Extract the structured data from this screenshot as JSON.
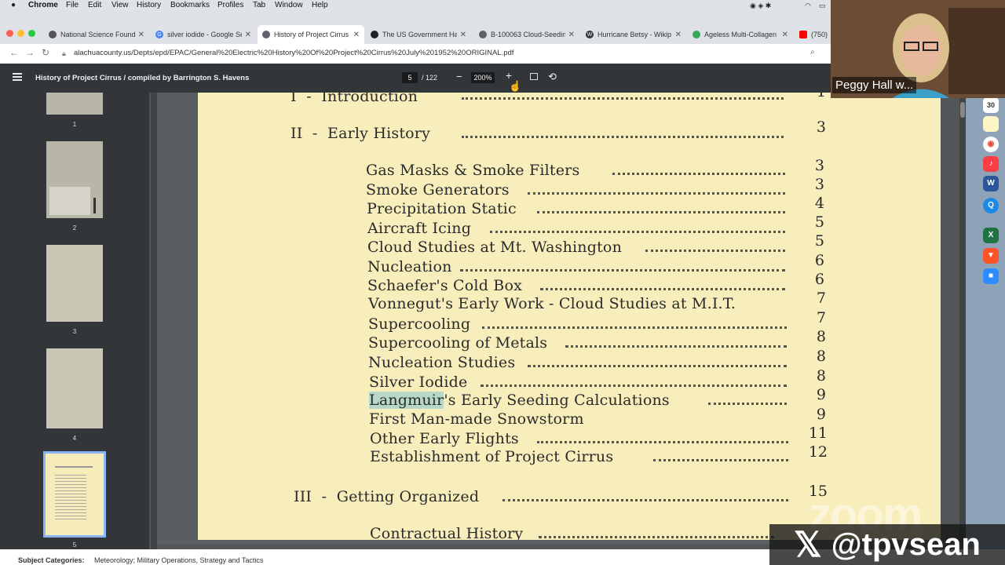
{
  "menubar": {
    "items": [
      "Chrome",
      "File",
      "Edit",
      "View",
      "History",
      "Bookmarks",
      "Profiles",
      "Tab",
      "Window",
      "Help"
    ]
  },
  "tabs": [
    {
      "title": "National Science Founda",
      "color": "#555"
    },
    {
      "title": "silver iodide - Google Se",
      "color": "#4285f4",
      "glyph": "G"
    },
    {
      "title": "History of Project Cirrus",
      "color": "#5f6368",
      "active": true
    },
    {
      "title": "The US Government Ha",
      "color": "#202124"
    },
    {
      "title": "B-100063 Cloud-Seedin",
      "color": "#5f6368"
    },
    {
      "title": "Hurricane Betsy - Wikip",
      "color": "#333",
      "glyph": "W"
    },
    {
      "title": "Ageless Multi-Collagen P",
      "color": "#34a853"
    },
    {
      "title": "(750)",
      "color": "#ff0000"
    }
  ],
  "address": {
    "url": "alachuacounty.us/Depts/epd/EPAC/General%20Electric%20History%20Of%20Project%20Cirrus%20July%201952%20ORIGINAL.pdf"
  },
  "pdf": {
    "title": "History of Project Cirrus / compiled by Barrington S. Havens",
    "page_current": "5",
    "page_total": "/ 122",
    "zoom": "200%"
  },
  "thumbnails": [
    {
      "num": "1"
    },
    {
      "num": "2"
    },
    {
      "num": "3"
    },
    {
      "num": "4"
    },
    {
      "num": "5"
    }
  ],
  "toc": {
    "sections": [
      {
        "roman": "I",
        "title": "Introduction",
        "page": "1"
      },
      {
        "roman": "II",
        "title": "Early History",
        "page": "3"
      },
      {
        "roman": "III",
        "title": "Getting Organized",
        "page": "15"
      }
    ],
    "entries": [
      {
        "title": "Gas Masks & Smoke Filters",
        "page": "3"
      },
      {
        "title": "Smoke Generators",
        "page": "3"
      },
      {
        "title": "Precipitation Static",
        "page": "4"
      },
      {
        "title": "Aircraft Icing",
        "page": "5"
      },
      {
        "title": "Cloud Studies at Mt. Washington",
        "page": "5"
      },
      {
        "title": "Nucleation",
        "page": "6"
      },
      {
        "title": "Schaefer's Cold Box",
        "page": "6"
      },
      {
        "title": "Vonnegut's Early Work - Cloud Studies at M.I.T.",
        "page": "7"
      },
      {
        "title": "Supercooling",
        "page": "7"
      },
      {
        "title": "Supercooling of Metals",
        "page": "8"
      },
      {
        "title": "Nucleation Studies",
        "page": "8"
      },
      {
        "title": "Silver Iodide",
        "page": "8"
      },
      {
        "title_highlight": "Langmuir",
        "title_rest": "'s Early Seeding Calculations",
        "page": "9"
      },
      {
        "title": "First Man-made Snowstorm",
        "page": "9"
      },
      {
        "title": "Other Early Flights",
        "page": "11"
      },
      {
        "title": "Establishment of Project Cirrus",
        "page": "12"
      }
    ],
    "sub_after": {
      "title": "Contractual History"
    }
  },
  "bottom": {
    "label": "Subject Categories:",
    "value": "Meteorology; Military Operations, Strategy and Tactics"
  },
  "webcam": {
    "name": "Peggy Hall w..."
  },
  "dock": {
    "calendar_day": "30"
  },
  "watermark": {
    "zoom": "zoom",
    "handle": "@tpvsean",
    "x_glyph": "𝕏"
  },
  "colors": {
    "highlight": "#b7d8c8",
    "page": "#f7eebc",
    "pdf_toolbar": "#323639"
  }
}
